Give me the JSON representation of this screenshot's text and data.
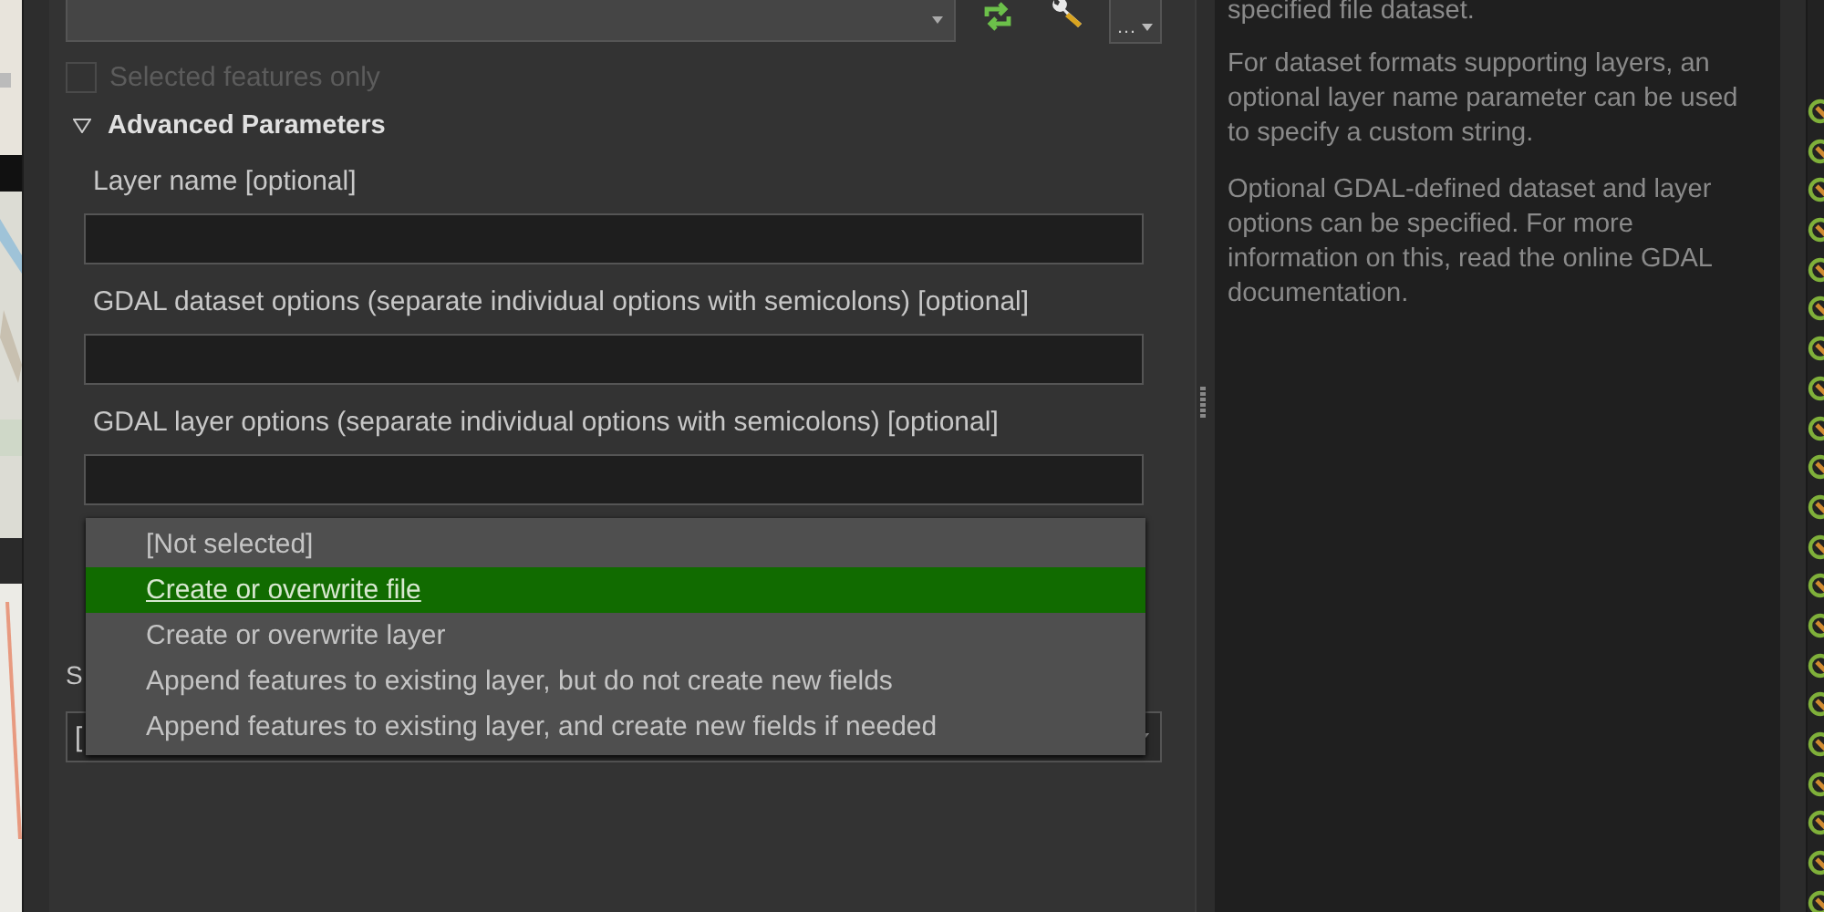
{
  "toolbar": {
    "more_button": {
      "label": "…"
    }
  },
  "selected_only": {
    "label": "Selected features only",
    "checked": false,
    "disabled": true
  },
  "advanced": {
    "label": "Advanced Parameters",
    "expanded": true,
    "parameters": [
      {
        "label": "Layer name [optional]"
      },
      {
        "label": "GDAL dataset options (separate individual options with semicolons) [optional]"
      },
      {
        "label": "GDAL layer options (separate individual options with semicolons) [optional]"
      }
    ]
  },
  "covered_row": {
    "label": "S",
    "value": "["
  },
  "dropdown": {
    "options": [
      {
        "label": "[Not selected]",
        "selected": false
      },
      {
        "label": "Create or overwrite file",
        "selected": true
      },
      {
        "label": "Create or overwrite layer",
        "selected": false
      },
      {
        "label": "Append features to existing layer, but do not create new fields",
        "selected": false
      },
      {
        "label": "Append features to existing layer, and create new fields if needed",
        "selected": false
      }
    ]
  },
  "help": {
    "paragraphs": [
      "specified file dataset.",
      "For dataset formats supporting layers, an optional layer name parameter can be used to specify a custom string.",
      "Optional GDAL-defined dataset and layer options can be specified. For more information on this, read the online GDAL documentation."
    ]
  }
}
